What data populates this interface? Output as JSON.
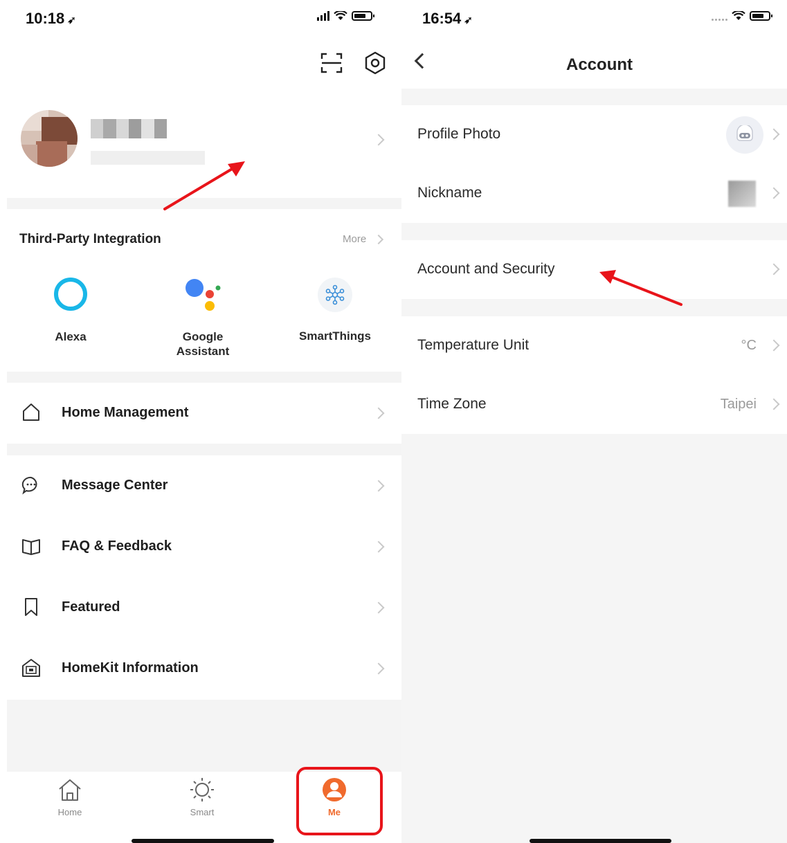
{
  "left": {
    "status": {
      "time": "10:18"
    },
    "profile": {},
    "third_party": {
      "title": "Third-Party Integration",
      "more": "More",
      "items": [
        {
          "line1": "Alexa",
          "line2": ""
        },
        {
          "line1": "Google",
          "line2": "Assistant"
        },
        {
          "line1": "SmartThings",
          "line2": ""
        }
      ]
    },
    "menu": {
      "home_management": "Home Management",
      "message_center": "Message Center",
      "faq": "FAQ & Feedback",
      "featured": "Featured",
      "homekit": "HomeKit Information"
    },
    "tabs": [
      {
        "label": "Home"
      },
      {
        "label": "Smart"
      },
      {
        "label": "Me"
      }
    ]
  },
  "right": {
    "status": {
      "time": "16:54"
    },
    "title": "Account",
    "rows": {
      "profile_photo": "Profile Photo",
      "nickname": "Nickname",
      "account_security": "Account and Security",
      "temperature": {
        "label": "Temperature Unit",
        "value": "°C"
      },
      "time_zone": {
        "label": "Time Zone",
        "value": "Taipei"
      }
    }
  },
  "colors": {
    "accent": "#f06a2d",
    "highlight": "#e8141a",
    "alexa": "#19b7e8"
  }
}
